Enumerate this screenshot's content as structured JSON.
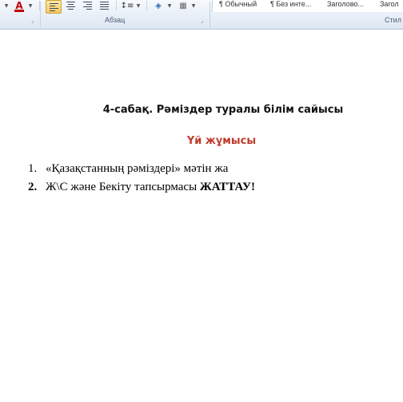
{
  "ribbon": {
    "paragraph_group_label": "Абзац",
    "styles_group_label": "Стил",
    "styles": [
      "¶ Обычный",
      "¶ Без инте...",
      "Заголово...",
      "Загол"
    ]
  },
  "document": {
    "title": "4-сабақ. Рәміздер туралы білім сайысы",
    "subtitle": "Үй жұмысы",
    "list": [
      {
        "num": "1.",
        "text": "«Қазақстанның рәміздері» мәтін жа",
        "bold_tail": ""
      },
      {
        "num": "2.",
        "text": "Ж\\С және Бекіту тапсырмасы ",
        "bold_tail": "ЖАТТАУ!"
      }
    ]
  }
}
